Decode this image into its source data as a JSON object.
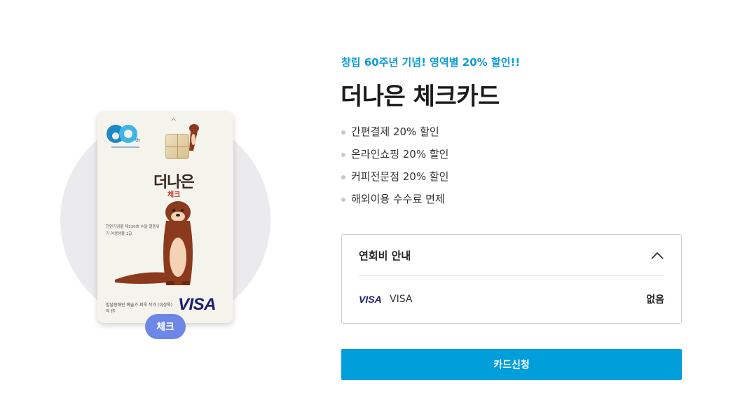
{
  "card": {
    "name_main": "더나은",
    "name_sub": "체크",
    "anniversary_badge": "60",
    "anniversary_suffix": "th",
    "small_text": "천연기념물 제330호 수달 멸종위기 야생생물 1급",
    "artist_text": "발달장애인 예술가 피욱 작가 (이상욱)의 作",
    "network_logo": "VISA",
    "type_badge": "체크"
  },
  "promo": "창립 60주년 기념! 영역별 20% 할인!!",
  "title": "더나은 체크카드",
  "benefits": [
    "간편결제 20% 할인",
    "온라인쇼핑 20% 할인",
    "커피전문점 20% 할인",
    "해외이용 수수료 면제"
  ],
  "annual_fee": {
    "heading": "연회비 안내",
    "rows": [
      {
        "logo": "VISA",
        "brand": "VISA",
        "fee": "없음"
      }
    ]
  },
  "apply_button": "카드신청",
  "colors": {
    "accent": "#009fdb",
    "promo": "#0c9bd4",
    "badge": "#6e86e6",
    "visa": "#1a1f71"
  },
  "icons": {
    "fee_toggle": "chevron-up-icon"
  }
}
